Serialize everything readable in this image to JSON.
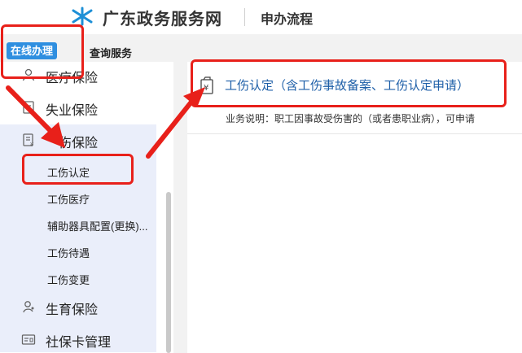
{
  "header": {
    "site_title": "广东政务服务网",
    "section_title": "申办流程"
  },
  "tabs": {
    "online": "在线办理",
    "query": "查询服务"
  },
  "sidebar": {
    "items": [
      {
        "label": "医疗保险",
        "icon": "person-icon"
      },
      {
        "label": "失业保险",
        "icon": "document-icon"
      },
      {
        "label": "伤保险",
        "icon": "document-icon"
      },
      {
        "label": "生育保险",
        "icon": "baby-icon"
      },
      {
        "label": "社保卡管理",
        "icon": "card-icon"
      }
    ],
    "subitems": [
      "工伤认定",
      "工伤医疗",
      "辅助器具配置(更换)...",
      "工伤待遇",
      "工伤变更"
    ]
  },
  "main": {
    "service_title": "工伤认定（含工伤事故备案、工伤认定申请）",
    "service_desc": "业务说明：职工因事故受伤害的（或者患职业病），可申请"
  },
  "colors": {
    "accent": "#2f8fe0",
    "link": "#1e5fa8",
    "annotation": "#e8201a",
    "selected_bg": "#eaeefa"
  }
}
